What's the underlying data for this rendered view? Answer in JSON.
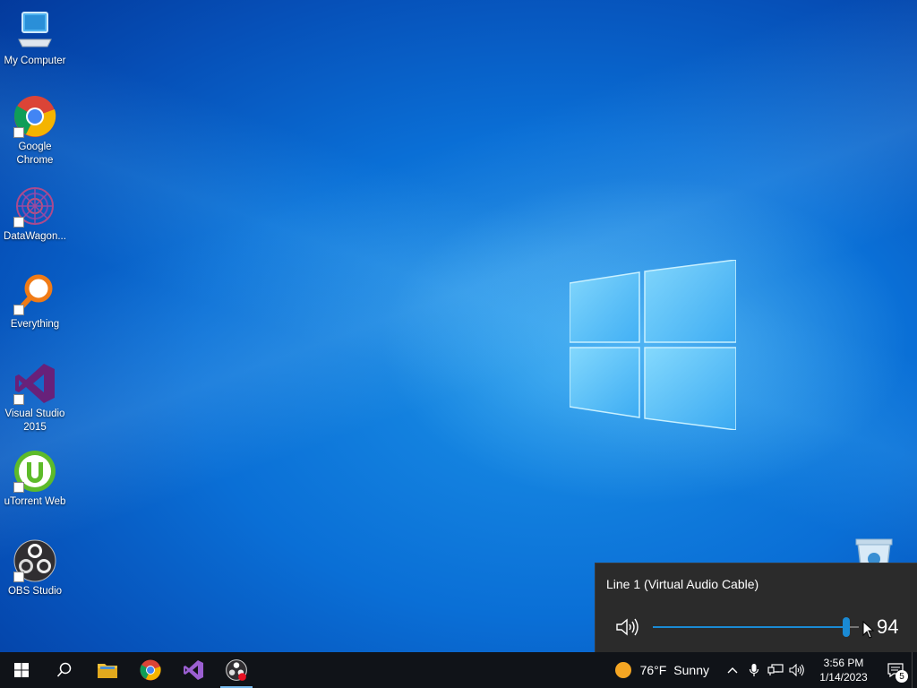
{
  "desktop": {
    "icons": [
      {
        "label": "My Computer"
      },
      {
        "label": "Google Chrome"
      },
      {
        "label": "DataWagon..."
      },
      {
        "label": "Everything"
      },
      {
        "label": "Visual Studio 2015"
      },
      {
        "label": "uTorrent Web"
      },
      {
        "label": "OBS Studio"
      }
    ]
  },
  "volume_flyout": {
    "device_name": "Line 1 (Virtual Audio Cable)",
    "volume_value": "94",
    "volume_fraction": 0.94
  },
  "taskbar": {
    "pinned": [
      "start",
      "search",
      "file-explorer",
      "chrome",
      "visual-studio",
      "obs-studio"
    ],
    "active": "obs-studio",
    "weather": {
      "temp": "76°F",
      "condition": "Sunny"
    },
    "clock": {
      "time": "3:56 PM",
      "date": "1/14/2023"
    },
    "notification_count": "5"
  },
  "colors": {
    "accent": "#1a8ad4",
    "flyout_bg": "#2b2b2b",
    "taskbar_bg": "#101318"
  }
}
